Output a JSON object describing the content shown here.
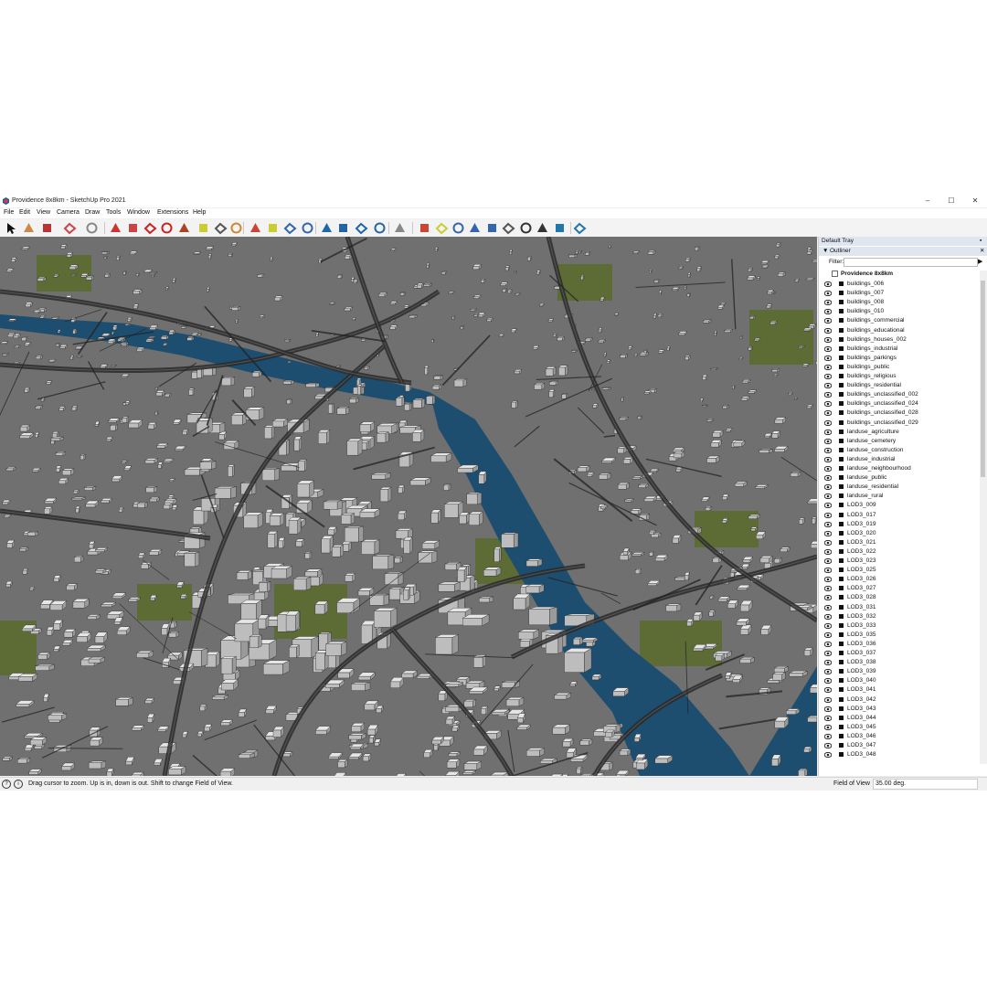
{
  "window": {
    "title": "Providence 8x8km - SketchUp Pro 2021",
    "controls": {
      "minimize": "–",
      "maximize": "☐",
      "close": "✕"
    }
  },
  "menu": [
    "File",
    "Edit",
    "View",
    "Camera",
    "Draw",
    "Tools",
    "Window",
    "Extensions",
    "Help"
  ],
  "toolbar": {
    "tools": [
      "select-icon",
      "eraser-icon",
      "pencil-icon",
      "arc-icon",
      "circle-icon",
      "push-pull-icon",
      "follow-me-icon",
      "move-icon",
      "rotate-icon",
      "scale-icon",
      "tape-measure-icon",
      "text-icon",
      "paint-bucket-icon",
      "orbit-icon",
      "pan-icon",
      "zoom-icon",
      "zoom-extents-icon",
      "section-icon",
      "section-fill-icon",
      "layers-icon",
      "geo-location-icon",
      "walk-icon",
      "look-around-icon",
      "zoom-window-icon",
      "previous-view-icon",
      "position-camera-icon",
      "eye-icon",
      "footprints-icon",
      "component-icon",
      "warehouse-icon",
      "extension-icon",
      "sandbox-icon"
    ]
  },
  "tray": {
    "title": "Default Tray",
    "outliner_title": "Outliner",
    "filter_label": "Filter:",
    "filter_value": "",
    "root": "Providence 8x8km",
    "items": [
      "buildings_006",
      "buildings_007",
      "buildings_008",
      "buildings_010",
      "buildings_commercial",
      "buildings_educational",
      "buildings_houses_002",
      "buildings_industrial",
      "buildings_parkings",
      "buildings_public",
      "buildings_religious",
      "buildings_residential",
      "buildings_unclassified_002",
      "buildings_unclassified_024",
      "buildings_unclassified_028",
      "buildings_unclassified_029",
      "landuse_agriculture",
      "landuse_cemetery",
      "landuse_construction",
      "landuse_industrial",
      "landuse_neighbourhood",
      "landuse_public",
      "landuse_residential",
      "landuse_rural",
      "LOD3_009",
      "LOD3_017",
      "LOD3_019",
      "LOD3_020",
      "LOD3_021",
      "LOD3_022",
      "LOD3_023",
      "LOD3_025",
      "LOD3_026",
      "LOD3_027",
      "LOD3_028",
      "LOD3_031",
      "LOD3_032",
      "LOD3_033",
      "LOD3_035",
      "LOD3_036",
      "LOD3_037",
      "LOD3_038",
      "LOD3_039",
      "LOD3_040",
      "LOD3_041",
      "LOD3_042",
      "LOD3_043",
      "LOD3_044",
      "LOD3_045",
      "LOD3_046",
      "LOD3_047",
      "LOD3_048"
    ]
  },
  "status": {
    "message": "Drag cursor to zoom.  Up is in, down is out. Shift to change Field of View.",
    "measurement_label": "Field of View",
    "measurement_value": "35.00 deg."
  },
  "colors": {
    "water": "#1d4e6f",
    "grass": "#5d6b34",
    "buildings": "#d9d9d9",
    "roads": "#2a2a2a"
  }
}
